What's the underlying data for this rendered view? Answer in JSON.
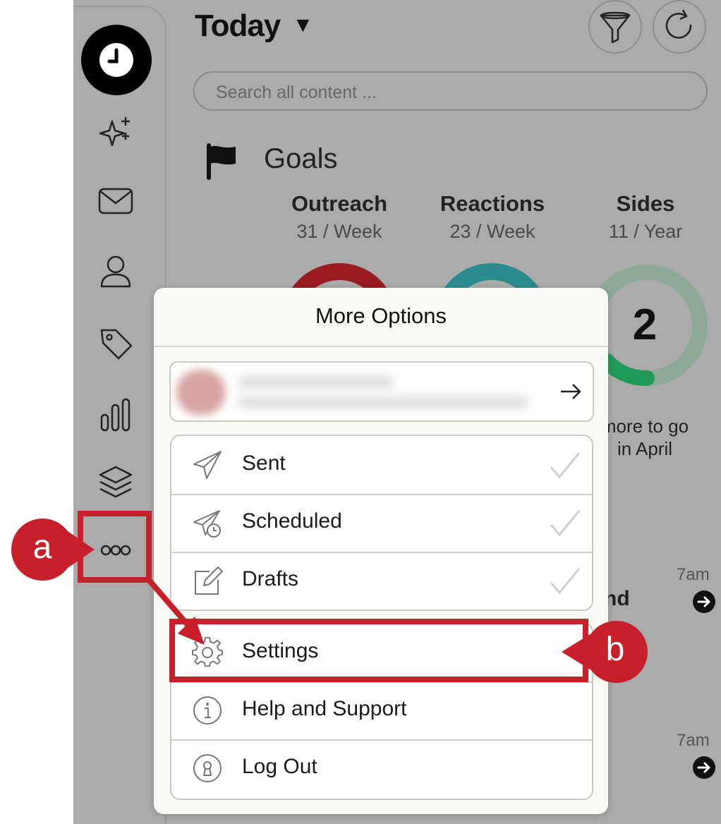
{
  "header": {
    "title": "Today",
    "title_caret": "▼",
    "filter_icon": "funnel-icon",
    "refresh_icon": "refresh-icon"
  },
  "search": {
    "placeholder": "Search all content ..."
  },
  "sidebar": {
    "items": [
      {
        "name": "clock-icon"
      },
      {
        "name": "sparkle-icon"
      },
      {
        "name": "mail-icon"
      },
      {
        "name": "person-icon"
      },
      {
        "name": "tag-icon"
      },
      {
        "name": "bar-chart-icon"
      },
      {
        "name": "layers-icon"
      },
      {
        "name": "more-options-icon"
      }
    ]
  },
  "goals": {
    "title": "Goals",
    "items": [
      {
        "name": "Outreach",
        "rate": "31 / Week",
        "color": "#9b1b22"
      },
      {
        "name": "Reactions",
        "rate": "23 / Week",
        "color": "#2b8c8f"
      },
      {
        "name": "Sides",
        "rate": "11 / Year",
        "value": "2",
        "color": "#1f9a59"
      }
    ],
    "to_go_line1": "more to go",
    "to_go_line2": "in April"
  },
  "feed": {
    "time1": "7am",
    "time2": "7am",
    "partial_text": "nd"
  },
  "modal": {
    "title": "More Options",
    "items_group1": [
      {
        "label": "Sent",
        "icon": "paper-plane-icon"
      },
      {
        "label": "Scheduled",
        "icon": "scheduled-plane-icon"
      },
      {
        "label": "Drafts",
        "icon": "edit-icon"
      }
    ],
    "items_group2": [
      {
        "label": "Settings",
        "icon": "gear-icon"
      },
      {
        "label": "Help and Support",
        "icon": "info-icon"
      },
      {
        "label": "Log Out",
        "icon": "keyhole-icon"
      }
    ]
  },
  "annotations": {
    "a": "a",
    "b": "b",
    "color": "#c8202b"
  }
}
